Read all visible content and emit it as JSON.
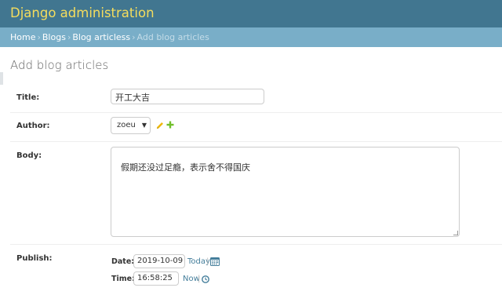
{
  "header": {
    "site_name": "Django administration"
  },
  "breadcrumbs": {
    "items": [
      "Home",
      "Blogs",
      "Blog articless"
    ],
    "separator": "›",
    "current": "Add blog articles"
  },
  "page": {
    "title": "Add blog articles"
  },
  "form": {
    "title": {
      "label": "Title:",
      "value": "开工大吉"
    },
    "author": {
      "label": "Author:",
      "value": "zoeu",
      "edit_icon": "pencil-icon",
      "add_icon": "plus-icon"
    },
    "body": {
      "label": "Body:",
      "value": "假期还没过足瘾，表示舍不得国庆"
    },
    "publish": {
      "label": "Publish:",
      "date_label": "Date:",
      "date_value": "2019-10-09",
      "today_link": "Today",
      "time_label": "Time:",
      "time_value": "16:58:25",
      "now_link": "Now",
      "pipe": "|",
      "calendar_icon": "calendar-icon",
      "clock_icon": "clock-icon"
    }
  },
  "colors": {
    "header_bg": "#417690",
    "brand_text": "#f5dd5d",
    "breadcrumb_bg": "#79aec8",
    "link": "#447e9b",
    "add_green": "#70bf2b",
    "edit_yellow": "#efb80b"
  }
}
